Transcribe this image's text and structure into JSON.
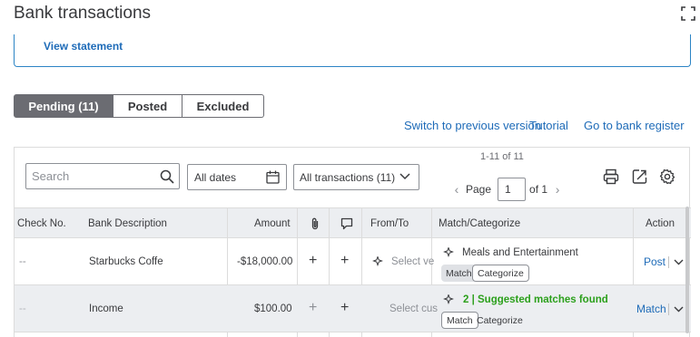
{
  "page": {
    "title": "Bank transactions"
  },
  "statement": {
    "link": "View statement"
  },
  "tabs": [
    {
      "label": "Pending (11)"
    },
    {
      "label": "Posted"
    },
    {
      "label": "Excluded"
    }
  ],
  "links": {
    "switch_version": "Switch to previous version",
    "tutorial": "Tutorial",
    "bank_register": "Go to bank register"
  },
  "filters": {
    "search_placeholder": "Search",
    "dates": "All dates",
    "transactions": "All transactions (11)"
  },
  "pagination": {
    "range": "1-11 of 11",
    "page_label": "Page",
    "page_value": "1",
    "of_label": "of 1"
  },
  "columns": {
    "check_no": "Check No.",
    "bank_description": "Bank Description",
    "amount": "Amount",
    "from_to": "From/To",
    "match_categorize": "Match/Categorize",
    "action": "Action"
  },
  "rows": [
    {
      "check_no": "--",
      "description": "Starbucks Coffe",
      "amount": "-$18,000.00",
      "from_to": "Select ve",
      "category": "Meals and Entertainment",
      "match_btn": "Match",
      "categorize_btn": "Categorize",
      "action": "Post"
    },
    {
      "check_no": "--",
      "description": "Income",
      "amount": "$100.00",
      "from_to": "Select cus",
      "category": "2 | Suggested matches found",
      "match_btn": "Match",
      "categorize_btn": "Categorize",
      "action": "Match"
    }
  ],
  "colors": {
    "accent_blue": "#1e6bb8",
    "success_green": "#2ca01c",
    "tab_active": "#6b6c72"
  },
  "icons": [
    "expand-icon",
    "search-icon",
    "calendar-icon",
    "chevron-down-icon",
    "print-icon",
    "export-icon",
    "gear-icon",
    "attachment-icon",
    "comment-icon",
    "sparkle-icon"
  ]
}
